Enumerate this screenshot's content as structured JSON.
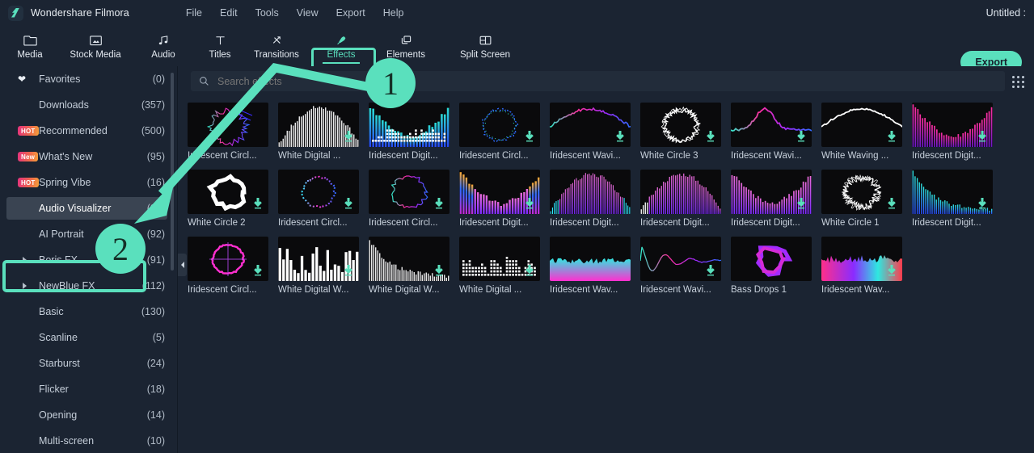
{
  "app": {
    "brand": "Wondershare Filmora",
    "logo_icon": "filmora-logo-icon",
    "project_title": "Untitled :"
  },
  "menu": {
    "items": [
      {
        "label": "File"
      },
      {
        "label": "Edit"
      },
      {
        "label": "Tools"
      },
      {
        "label": "View"
      },
      {
        "label": "Export"
      },
      {
        "label": "Help"
      }
    ]
  },
  "toolbar": {
    "tabs": [
      {
        "label": "Media",
        "icon": "folder-icon",
        "active": false
      },
      {
        "label": "Stock Media",
        "icon": "stock-media-icon",
        "active": false
      },
      {
        "label": "Audio",
        "icon": "music-note-icon",
        "active": false
      },
      {
        "label": "Titles",
        "icon": "text-t-icon",
        "active": false
      },
      {
        "label": "Transitions",
        "icon": "transitions-arrows-icon",
        "active": false
      },
      {
        "label": "Effects",
        "icon": "effects-sparkle-icon",
        "active": true
      },
      {
        "label": "Elements",
        "icon": "elements-layers-icon",
        "active": false
      },
      {
        "label": "Split Screen",
        "icon": "split-screen-icon",
        "active": false
      }
    ],
    "export_label": "Export",
    "accent_color": "#5ae0bd"
  },
  "sidebar": {
    "items": [
      {
        "label": "Favorites",
        "count": "(0)",
        "icon": "heart-icon",
        "badge": null,
        "caret": false,
        "selected": false
      },
      {
        "label": "Downloads",
        "count": "(357)",
        "icon": null,
        "badge": null,
        "caret": false,
        "selected": false
      },
      {
        "label": "Recommended",
        "count": "(500)",
        "icon": null,
        "badge": "HOT",
        "caret": false,
        "selected": false
      },
      {
        "label": "What's New",
        "count": "(95)",
        "icon": null,
        "badge": "New",
        "caret": false,
        "selected": false
      },
      {
        "label": "Spring Vibe",
        "count": "(16)",
        "icon": null,
        "badge": "HOT",
        "caret": false,
        "selected": false
      },
      {
        "label": "Audio Visualizer",
        "count": "(25)",
        "icon": null,
        "badge": null,
        "caret": false,
        "selected": true
      },
      {
        "label": "AI Portrait",
        "count": "(92)",
        "icon": null,
        "badge": null,
        "caret": false,
        "selected": false
      },
      {
        "label": "Boris FX",
        "count": "(91)",
        "icon": null,
        "badge": null,
        "caret": true,
        "selected": false
      },
      {
        "label": "NewBlue FX",
        "count": "(112)",
        "icon": null,
        "badge": null,
        "caret": true,
        "selected": false
      },
      {
        "label": "Basic",
        "count": "(130)",
        "icon": null,
        "badge": null,
        "caret": false,
        "selected": false
      },
      {
        "label": "Scanline",
        "count": "(5)",
        "icon": null,
        "badge": null,
        "caret": false,
        "selected": false
      },
      {
        "label": "Starburst",
        "count": "(24)",
        "icon": null,
        "badge": null,
        "caret": false,
        "selected": false
      },
      {
        "label": "Flicker",
        "count": "(18)",
        "icon": null,
        "badge": null,
        "caret": false,
        "selected": false
      },
      {
        "label": "Opening",
        "count": "(14)",
        "icon": null,
        "badge": null,
        "caret": false,
        "selected": false
      },
      {
        "label": "Multi-screen",
        "count": "(10)",
        "icon": null,
        "badge": null,
        "caret": false,
        "selected": false
      }
    ]
  },
  "search": {
    "placeholder": "Search effects",
    "value": "",
    "icon": "search-icon"
  },
  "grid_view": {
    "toggle_icon": "grid-view-icon"
  },
  "collapse": {
    "icon": "collapse-left-arrow-icon"
  },
  "effects": [
    {
      "name": "Iridescent Circl...",
      "art": "scribble-arc",
      "download": false
    },
    {
      "name": "White  Digital ...",
      "art": "white-spindle",
      "download": true
    },
    {
      "name": "Iridescent Digit...",
      "art": "blue-dots-eq",
      "download": false
    },
    {
      "name": "Iridescent Circl...",
      "art": "blue-ring",
      "download": true
    },
    {
      "name": "Iridescent Wavi...",
      "art": "pink-dip-wave",
      "download": true
    },
    {
      "name": "White Circle 3",
      "art": "white-ring-3",
      "download": true
    },
    {
      "name": "Iridescent Wavi...",
      "art": "pink-peak-wave",
      "download": true
    },
    {
      "name": "White Waving ...",
      "art": "white-dip-wave",
      "download": true
    },
    {
      "name": "Iridescent Digit...",
      "art": "pink-bars",
      "download": true
    },
    {
      "name": "White Circle 2",
      "art": "white-blob-ring",
      "download": true
    },
    {
      "name": "Iridescent Circl...",
      "art": "cyan-dot-ring",
      "download": true
    },
    {
      "name": "Iridescent Circl...",
      "art": "purple-ring",
      "download": true
    },
    {
      "name": "Iridescent Digit...",
      "art": "orange-bars",
      "download": true
    },
    {
      "name": "Iridescent Digit...",
      "art": "magenta-spindle",
      "download": false
    },
    {
      "name": "Iridescent Digit...",
      "art": "magenta-spindle2",
      "download": false
    },
    {
      "name": "Iridescent Digit...",
      "art": "violet-bars",
      "download": true
    },
    {
      "name": "White Circle 1",
      "art": "white-fuzz-ring",
      "download": true
    },
    {
      "name": "Iridescent Digit...",
      "art": "cyan-decay-bars",
      "download": true
    },
    {
      "name": "Iridescent Circl...",
      "art": "glow-ring",
      "download": true
    },
    {
      "name": "White Digital W...",
      "art": "white-bars-1",
      "download": true
    },
    {
      "name": "White Digital W...",
      "art": "white-bars-2",
      "download": true
    },
    {
      "name": "White  Digital ...",
      "art": "white-dot-grid",
      "download": true
    },
    {
      "name": "Iridescent Wav...",
      "art": "pink-fill-wave",
      "download": false
    },
    {
      "name": "Iridescent Wavi...",
      "art": "damped-wave",
      "download": true
    },
    {
      "name": "Bass Drops 1",
      "art": "bass-blob",
      "download": false
    },
    {
      "name": "Iridescent Wav...",
      "art": "multi-fill-wave",
      "download": true
    }
  ],
  "annotations": {
    "step1": "1",
    "step2": "2",
    "color": "#5ae0bd"
  }
}
